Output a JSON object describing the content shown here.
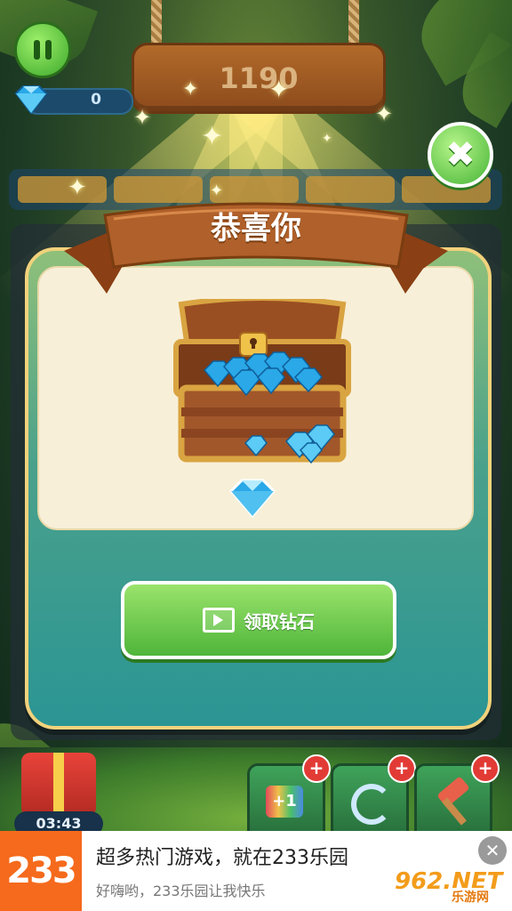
{
  "hud": {
    "gem_count": "0",
    "score": "1190"
  },
  "dialog": {
    "title": "恭喜你",
    "claim_label": "领取钻石",
    "close_symbol": "✖"
  },
  "bottom": {
    "timer": "03:43",
    "tool_plus_label": "+1",
    "plus_symbol": "+"
  },
  "ad": {
    "logo_text": "233",
    "title": "超多热门游戏，就在233乐园",
    "subtitle": "好嗨哟，233乐园让我快乐",
    "close_symbol": "✕",
    "watermark_brand": "962.NET",
    "watermark_sub": "乐游网"
  },
  "colors": {
    "accent_green": "#4fb53a",
    "ribbon_brown": "#a4531d",
    "panel_cream": "#f7efd8",
    "ad_orange": "#f56a1c",
    "gem_blue": "#2aa8e8"
  },
  "icons": [
    "pause-icon",
    "diamond-icon",
    "close-icon",
    "video-icon",
    "gift-icon",
    "refresh-icon",
    "hammer-icon"
  ]
}
